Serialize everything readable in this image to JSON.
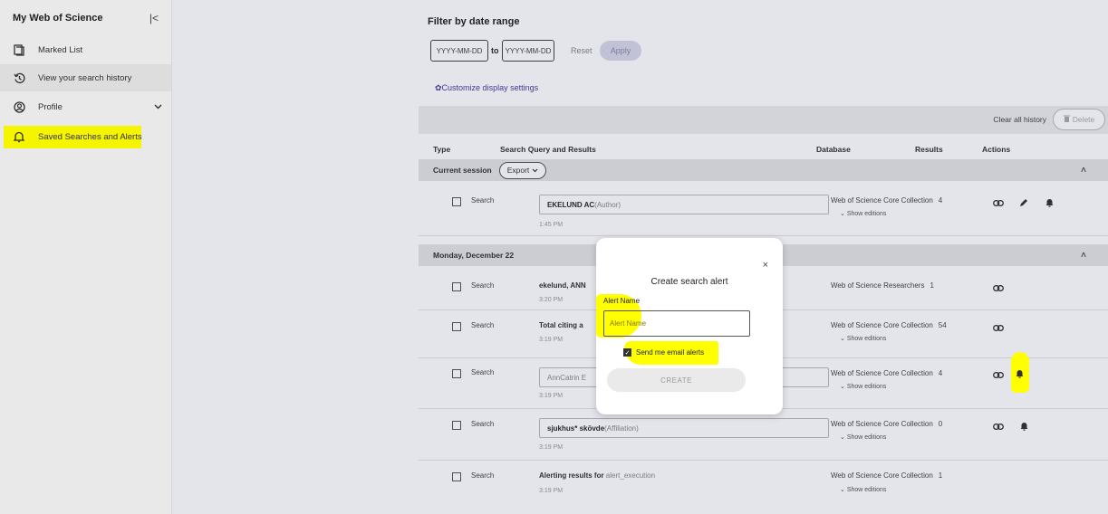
{
  "sidebar": {
    "title": "My Web of Science",
    "collapse_glyph": "|<",
    "items": [
      {
        "label": "Marked List"
      },
      {
        "label": "View your search history"
      },
      {
        "label": "Profile"
      },
      {
        "label": "Saved Searches and Alerts"
      }
    ]
  },
  "filter": {
    "title": "Filter by date range",
    "from_placeholder": "YYYY-MM-DD",
    "to_label": "to",
    "to_placeholder": "YYYY-MM-DD",
    "reset_label": "Reset",
    "apply_label": "Apply",
    "customize_label": "Customize display settings"
  },
  "toolbar": {
    "clear_all_label": "Clear all history",
    "delete_label": "Delete"
  },
  "columns": {
    "type": "Type",
    "query": "Search Query and Results",
    "database": "Database",
    "results": "Results",
    "actions": "Actions"
  },
  "current_session": {
    "label": "Current session",
    "export_label": "Export",
    "rows": [
      {
        "type": "Search",
        "query": "EKELUND AC",
        "query_sub": " (Author)",
        "time": "1:45 PM",
        "database": "Web of Science Core Collection",
        "count": "4",
        "editions": "Show editions"
      }
    ]
  },
  "monday": {
    "label": "Monday, December 22",
    "rows": [
      {
        "type": "Search",
        "query": "ekelund, ANN",
        "query_sub": "",
        "time": "3:20 PM",
        "database": "Web of Science Researchers",
        "count": "1",
        "editions": ""
      },
      {
        "type": "Search",
        "query": "Total citing a",
        "query_sub": "",
        "time": "3:19 PM",
        "database": "Web of Science Core Collection",
        "count": "54",
        "editions": "Show editions"
      },
      {
        "type": "Search",
        "query": "AnnCatrin E",
        "query_sub": "",
        "time": "3:19 PM",
        "database": "Web of Science Core Collection",
        "count": "4",
        "editions": "Show editions"
      },
      {
        "type": "Search",
        "query": "sjukhus* skövde",
        "query_sub": " (Affiliation)",
        "time": "3:19 PM",
        "database": "Web of Science Core Collection",
        "count": "0",
        "editions": "Show editions"
      },
      {
        "type": "Search",
        "query": "Alerting results for",
        "query_sub": " alert_execution",
        "time": "3:19 PM",
        "database": "Web of Science Core Collection",
        "count": "1",
        "editions": "Show editions"
      }
    ]
  },
  "modal": {
    "title": "Create search alert",
    "close_glyph": "×",
    "alert_name_label": "Alert Name",
    "alert_name_placeholder": "Alert Name",
    "email_label": "Send me email alerts",
    "create_label": "CREATE"
  },
  "colors": {
    "highlight": "#ffff00",
    "accent": "#4b3ca0"
  }
}
